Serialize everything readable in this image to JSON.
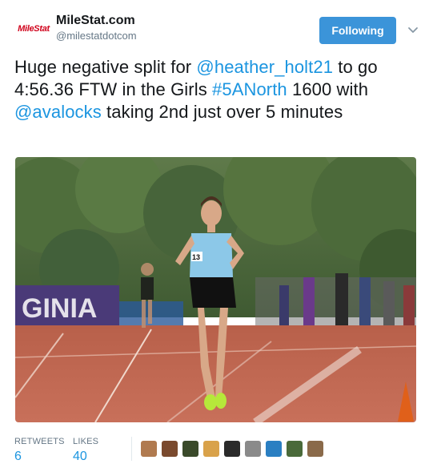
{
  "account": {
    "display_name": "MileStat.com",
    "handle": "@milestatdotcom",
    "avatar_text": "MileStat"
  },
  "follow_button": {
    "label": "Following"
  },
  "tweet": {
    "segments": [
      {
        "text": "Huge negative split for ",
        "link": false
      },
      {
        "text": "@heather_holt21",
        "link": true
      },
      {
        "text": " to go 4:56.36 FTW in the Girls ",
        "link": false
      },
      {
        "text": "#5ANorth",
        "link": true
      },
      {
        "text": " 1600 with ",
        "link": false
      },
      {
        "text": "@avalocks",
        "link": true
      },
      {
        "text": " taking 2nd just over 5 minutes",
        "link": false
      }
    ]
  },
  "photo": {
    "banner_text": "GINIA",
    "bib_number": "13"
  },
  "stats": {
    "retweets_label": "RETWEETS",
    "retweets_value": "6",
    "likes_label": "LIKES",
    "likes_value": "40"
  },
  "likers": [
    {
      "color": "#b07a4f"
    },
    {
      "color": "#7a4a2e"
    },
    {
      "color": "#3a4a2a"
    },
    {
      "color": "#d9a24a"
    },
    {
      "color": "#2a2a2a"
    },
    {
      "color": "#8a8a8a"
    },
    {
      "color": "#2a7fc2"
    },
    {
      "color": "#4a6a3a"
    },
    {
      "color": "#8a6a4a"
    }
  ],
  "colors": {
    "accent": "#1b95e0",
    "button": "#3b94d9",
    "brand_red": "#d0021b"
  }
}
